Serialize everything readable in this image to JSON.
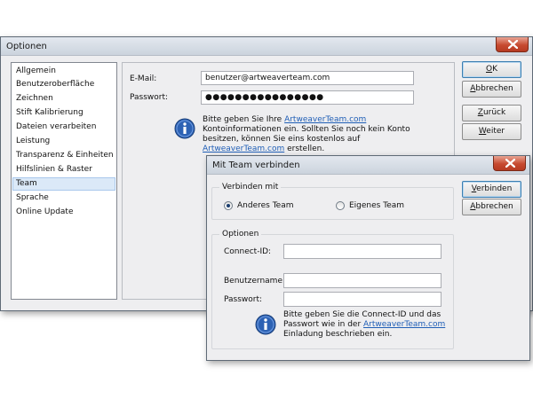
{
  "options_window": {
    "title": "Optionen",
    "sidebar": {
      "items": [
        {
          "label": "Allgemein"
        },
        {
          "label": "Benutzeroberfläche"
        },
        {
          "label": "Zeichnen"
        },
        {
          "label": "Stift Kalibrierung"
        },
        {
          "label": "Dateien verarbeiten"
        },
        {
          "label": "Leistung"
        },
        {
          "label": "Transparenz & Einheiten"
        },
        {
          "label": "Hilfslinien & Raster"
        },
        {
          "label": "Team",
          "selected": true
        },
        {
          "label": "Sprache"
        },
        {
          "label": "Online Update"
        }
      ]
    },
    "email": {
      "label": "E-Mail:",
      "value": "benutzer@artweaverteam.com"
    },
    "password": {
      "label": "Passwort:",
      "value": "●●●●●●●●●●●●●●●●"
    },
    "info": {
      "icon": "info-icon",
      "line1_prefix": "Bitte geben Sie Ihre ",
      "line1_link": "ArtweaverTeam.com",
      "line2": "Kontoinformationen ein. Sollten Sie noch kein Konto",
      "line3": "besitzen, können Sie eins kostenlos auf",
      "line4_link": "ArtweaverTeam.com",
      "line4_suffix": " erstellen."
    },
    "buttons": {
      "ok": {
        "first": "O",
        "rest": "K"
      },
      "cancel": {
        "first": "A",
        "rest": "bbrechen"
      },
      "back": {
        "first": "Z",
        "rest": "urück"
      },
      "next": {
        "first": "W",
        "rest": "eiter"
      }
    }
  },
  "team_dialog": {
    "title": "Mit Team verbinden",
    "connect_group": {
      "title": "Verbinden mit",
      "option_other": "Anderes Team",
      "option_own": "Eigenes Team",
      "selected": "Anderes Team"
    },
    "options_group": {
      "title": "Optionen",
      "connect_id_label": "Connect-ID:",
      "username_label": "Benutzername:",
      "password_label": "Passwort:",
      "connect_id_value": "",
      "username_value": "",
      "password_value": ""
    },
    "info": {
      "icon": "info-icon",
      "line1": "Bitte geben Sie die Connect-ID und das",
      "line2_prefix": "Passwort wie in der ",
      "line2_link": "ArtweaverTeam.com",
      "line3": "Einladung beschrieben ein."
    },
    "buttons": {
      "connect": {
        "first": "V",
        "rest": "erbinden"
      },
      "cancel": {
        "first": "A",
        "rest": "bbrechen"
      }
    }
  },
  "colors": {
    "link": "#1f5eb6",
    "selection": "#dbe9f8",
    "close_button": "#c74a30",
    "info_icon": "#2d62b4"
  }
}
